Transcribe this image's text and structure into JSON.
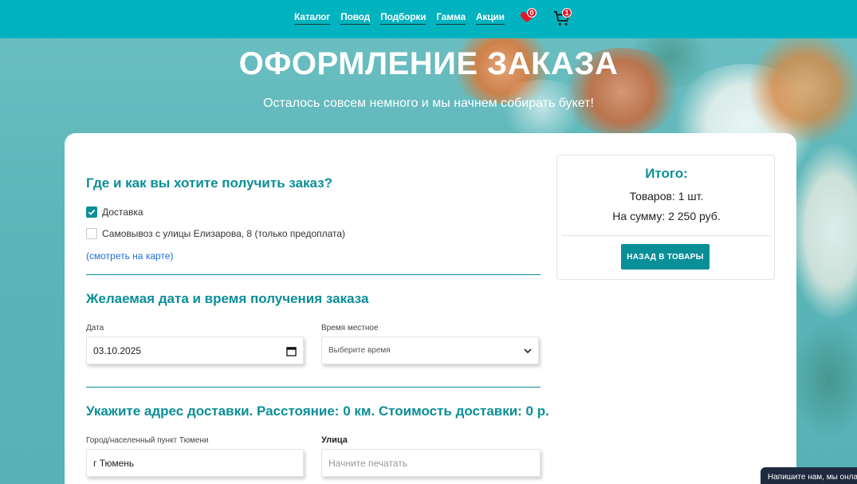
{
  "nav": {
    "links": [
      "Каталог",
      "Повод",
      "Подборки",
      "Гамма",
      "Акции"
    ],
    "wishlist_count": "0",
    "cart_count": "1"
  },
  "hero": {
    "title": "ОФОРМЛЕНИЕ ЗАКАЗА",
    "subtitle": "Осталось совсем немного и мы начнем собирать букет!"
  },
  "delivery_method": {
    "title": "Где и как вы хотите получить заказ?",
    "options": [
      {
        "label": "Доставка",
        "checked": true
      },
      {
        "label": "Самовывоз с улицы Елизарова, 8 (только предоплата)",
        "checked": false
      }
    ],
    "map_link": "(смотреть на карте)"
  },
  "datetime": {
    "title": "Желаемая дата и время получения заказа",
    "date_label": "Дата",
    "date_value": "03.10.2025",
    "time_label": "Время местное",
    "time_value": "Выберите время"
  },
  "address": {
    "title": "Укажите адрес доставки. Расстояние: 0 км. Стоимость доставки: 0 р.",
    "city_label": "Город/населенный пункт Тюмени",
    "city_value": "г Тюмень",
    "street_label": "Улица",
    "street_placeholder": "Начните печатать"
  },
  "summary": {
    "title": "Итого:",
    "items": "Товаров: 1 шт.",
    "total": "На сумму: 2 250 руб.",
    "back_button": "НАЗАД В ТОВАРЫ"
  },
  "chat": {
    "label": "Напишите нам, мы онлайн"
  },
  "colors": {
    "accent": "#00b3be",
    "heading": "#0a8f98",
    "badge": "#e0172c"
  }
}
